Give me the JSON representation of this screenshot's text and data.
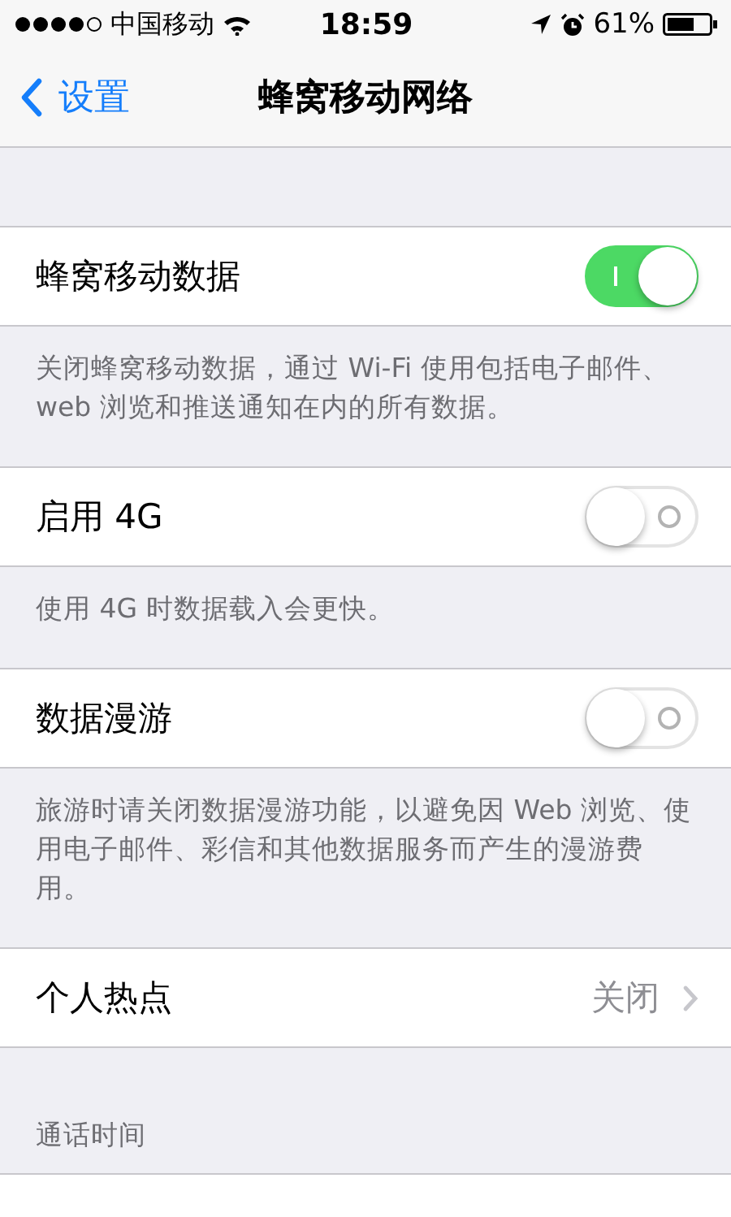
{
  "status_bar": {
    "carrier": "中国移动",
    "time": "18:59",
    "battery": "61%"
  },
  "nav": {
    "back": "设置",
    "title": "蜂窝移动网络"
  },
  "sections": [
    {
      "kind": "toggle",
      "label": "蜂窝移动数据",
      "on": true,
      "footer": "关闭蜂窝移动数据，通过 Wi-Fi 使用包括电子邮件、web 浏览和推送通知在内的所有数据。"
    },
    {
      "kind": "toggle",
      "label": "启用 4G",
      "on": false,
      "footer": "使用 4G 时数据载入会更快。"
    },
    {
      "kind": "toggle",
      "label": "数据漫游",
      "on": false,
      "footer": "旅游时请关闭数据漫游功能，以避免因 Web 浏览、使用电子邮件、彩信和其他数据服务而产生的漫游费用。"
    },
    {
      "kind": "link",
      "label": "个人热点",
      "value": "关闭"
    }
  ],
  "section_header": "通话时间"
}
